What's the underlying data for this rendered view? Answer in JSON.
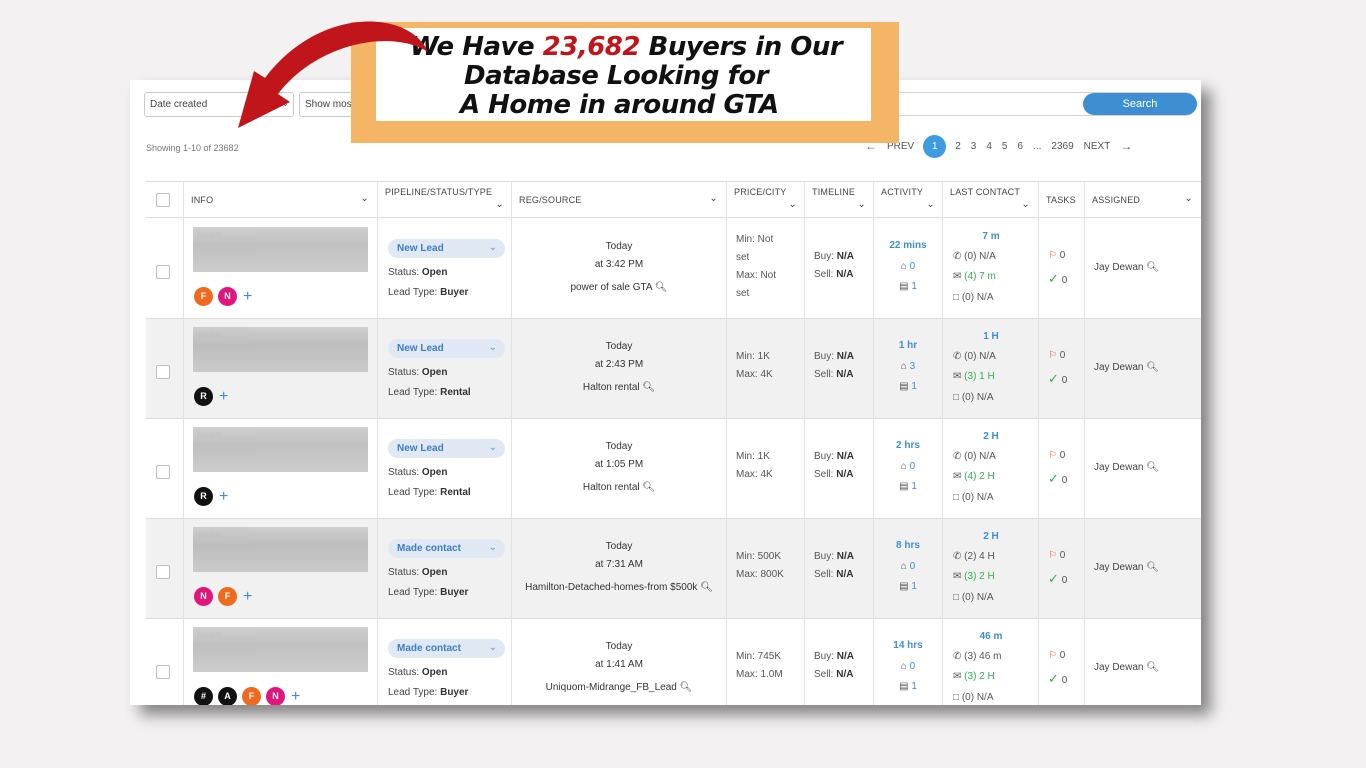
{
  "toolbar": {
    "date_select": "Date created",
    "sort_select": "Show mos",
    "search_button": "Search"
  },
  "showing": "Showing 1-10 of 23682",
  "pager": {
    "prev": "PREV",
    "pages": [
      "1",
      "2",
      "3",
      "4",
      "5",
      "6"
    ],
    "ellipsis": "...",
    "last": "2369",
    "next": "NEXT"
  },
  "headers": {
    "info": "INFO",
    "pipeline": "PIPELINE/STATUS/TYPE",
    "reg": "REG/SOURCE",
    "price": "PRICE/CITY",
    "timeline": "TIMELINE",
    "activity": "ACTIVITY",
    "last_contact": "LAST CONTACT",
    "tasks": "TASKS",
    "assigned": "ASSIGNED"
  },
  "rows": [
    {
      "pipeline": "New Lead",
      "status": "Open",
      "lead_type": "Buyer",
      "reg_day": "Today",
      "reg_time": "at 3:42 PM",
      "source": "power of sale GTA",
      "price_lines": [
        "Min: Not",
        "set",
        "Max: Not",
        "set"
      ],
      "buy": "N/A",
      "sell": "N/A",
      "act_time": "22 mins",
      "act_home": "0",
      "act_db": "1",
      "lc_head": "7 m",
      "lc_call": "(0) N/A",
      "lc_mail": "(4) 7 m",
      "lc_chat": "(0) N/A",
      "task_flag": "0",
      "task_check": "0",
      "assigned": "Jay Dewan",
      "tags": [
        {
          "l": "F",
          "c": "#f06a1d"
        },
        {
          "l": "N",
          "c": "#e2157a"
        }
      ]
    },
    {
      "pipeline": "New Lead",
      "status": "Open",
      "lead_type": "Rental",
      "reg_day": "Today",
      "reg_time": "at 2:43 PM",
      "source": "Halton rental",
      "price_lines": [
        "Min: 1K",
        "Max: 4K"
      ],
      "buy": "N/A",
      "sell": "N/A",
      "act_time": "1 hr",
      "act_home": "3",
      "act_db": "1",
      "lc_head": "1 H",
      "lc_call": "(0) N/A",
      "lc_mail": "(3) 1 H",
      "lc_chat": "(0) N/A",
      "task_flag": "0",
      "task_check": "0",
      "assigned": "Jay Dewan",
      "tags": [
        {
          "l": "R",
          "c": "#111111"
        }
      ]
    },
    {
      "pipeline": "New Lead",
      "status": "Open",
      "lead_type": "Rental",
      "reg_day": "Today",
      "reg_time": "at 1:05 PM",
      "source": "Halton rental",
      "price_lines": [
        "Min: 1K",
        "Max: 4K"
      ],
      "buy": "N/A",
      "sell": "N/A",
      "act_time": "2 hrs",
      "act_home": "0",
      "act_db": "1",
      "lc_head": "2 H",
      "lc_call": "(0) N/A",
      "lc_mail": "(4) 2 H",
      "lc_chat": "(0) N/A",
      "task_flag": "0",
      "task_check": "0",
      "assigned": "Jay Dewan",
      "tags": [
        {
          "l": "R",
          "c": "#111111"
        }
      ]
    },
    {
      "pipeline": "Made contact",
      "status": "Open",
      "lead_type": "Buyer",
      "reg_day": "Today",
      "reg_time": "at 7:31 AM",
      "source": "Hamilton-Detached-homes-from $500k",
      "price_lines": [
        "Min: 500K",
        "Max: 800K"
      ],
      "buy": "N/A",
      "sell": "N/A",
      "act_time": "8 hrs",
      "act_home": "0",
      "act_db": "1",
      "lc_head": "2 H",
      "lc_call": "(2) 4 H",
      "lc_mail": "(3) 2 H",
      "lc_chat": "(0) N/A",
      "task_flag": "0",
      "task_check": "0",
      "assigned": "Jay Dewan",
      "tags": [
        {
          "l": "N",
          "c": "#e2157a"
        },
        {
          "l": "F",
          "c": "#f06a1d"
        }
      ]
    },
    {
      "pipeline": "Made contact",
      "status": "Open",
      "lead_type": "Buyer",
      "reg_day": "Today",
      "reg_time": "at 1:41 AM",
      "source": "Uniquom-Midrange_FB_Lead",
      "price_lines": [
        "Min: 745K",
        "Max: 1.0M"
      ],
      "buy": "N/A",
      "sell": "N/A",
      "act_time": "14 hrs",
      "act_home": "0",
      "act_db": "1",
      "lc_head": "46 m",
      "lc_call": "(3) 46 m",
      "lc_mail": "(3) 2 H",
      "lc_chat": "(0) N/A",
      "task_flag": "0",
      "task_check": "0",
      "assigned": "Jay Dewan",
      "tags": [
        {
          "l": "#",
          "c": "#111111"
        },
        {
          "l": "A",
          "c": "#111111"
        },
        {
          "l": "F",
          "c": "#f06a1d"
        },
        {
          "l": "N",
          "c": "#e2157a"
        }
      ]
    }
  ],
  "banner": {
    "line1_pre": "We Have ",
    "line1_num": "23,682",
    "line1_post": " Buyers in Our",
    "line2": "Database Looking for",
    "line3": "A Home in around GTA"
  },
  "colors": {
    "accent": "#3d8fd1",
    "banner": "#f5b566",
    "arrow": "#c0161b",
    "highlight": "#c0161b"
  }
}
